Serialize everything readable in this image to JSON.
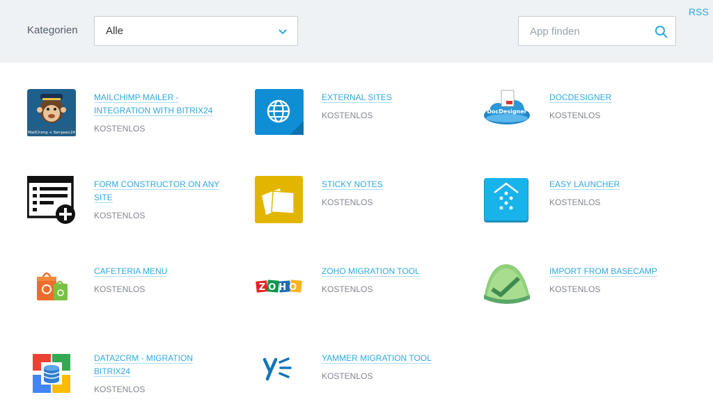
{
  "filter": {
    "category_label": "Kategorien",
    "category_value": "Alle",
    "search_placeholder": "App finden",
    "rss_label": "RSS"
  },
  "apps": [
    {
      "name": "MAILCHIMP MAILER - INTEGRATION WITH BITRIX24",
      "price": "KOSTENLOS",
      "icon": "mailchimp-icon",
      "icon_caption": "MailChimp + Битрикс24"
    },
    {
      "name": "EXTERNAL SITES",
      "price": "KOSTENLOS",
      "icon": "globe-icon"
    },
    {
      "name": "DOCDESIGNER",
      "price": "KOSTENLOS",
      "icon": "docdesigner-icon",
      "icon_caption": "DocDesigner"
    },
    {
      "name": "FORM CONSTRUCTOR ON ANY SITE",
      "price": "KOSTENLOS",
      "icon": "form-constructor-icon"
    },
    {
      "name": "STICKY NOTES",
      "price": "KOSTENLOS",
      "icon": "sticky-notes-icon"
    },
    {
      "name": "EASY LAUNCHER",
      "price": "KOSTENLOS",
      "icon": "launcher-icon"
    },
    {
      "name": "CAFETERIA MENU",
      "price": "KOSTENLOS",
      "icon": "shopping-bag-icon"
    },
    {
      "name": "ZOHO MIGRATION TOOL",
      "price": "KOSTENLOS",
      "icon": "zoho-icon",
      "icon_caption": "ZOHO"
    },
    {
      "name": "IMPORT FROM BASECAMP",
      "price": "KOSTENLOS",
      "icon": "basecamp-icon"
    },
    {
      "name": "DATA2CRM - MIGRATION BITRIX24",
      "price": "KOSTENLOS",
      "icon": "data-migration-icon"
    },
    {
      "name": "YAMMER MIGRATION TOOL",
      "price": "KOSTENLOS",
      "icon": "yammer-icon"
    }
  ],
  "colors": {
    "accent": "#2fa8e0",
    "topbar": "#eef2f4",
    "price": "#80868e"
  }
}
